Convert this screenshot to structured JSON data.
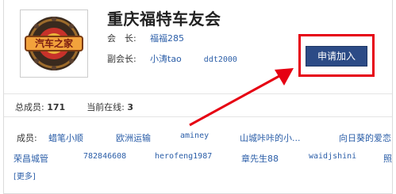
{
  "group": {
    "title": "重庆福特车友会",
    "logo_text": "汽车之家"
  },
  "roles": {
    "president_label": "会　长:",
    "president_name": "福福285",
    "vice_label": "副会长:",
    "vice_names": [
      "小涛tao",
      "ddt2000"
    ]
  },
  "join_button": "申请加入",
  "stats": {
    "total_label": "总成员:",
    "total_value": "171",
    "online_label": "当前在线:",
    "online_value": "3"
  },
  "members": {
    "label": "成员:",
    "row1": [
      "蜡笔小顺",
      "欧洲运输",
      "aminey",
      "山城咔咔的小...",
      "向日葵的爱恋"
    ],
    "row2": [
      "荣昌城管",
      "782846608",
      "herofeng1987",
      "章先生88",
      "waidjshini",
      "照"
    ],
    "more": "[更多]"
  },
  "colors": {
    "highlight": "#e60012",
    "button": "#2c4b86",
    "link": "#2b5ea8"
  }
}
